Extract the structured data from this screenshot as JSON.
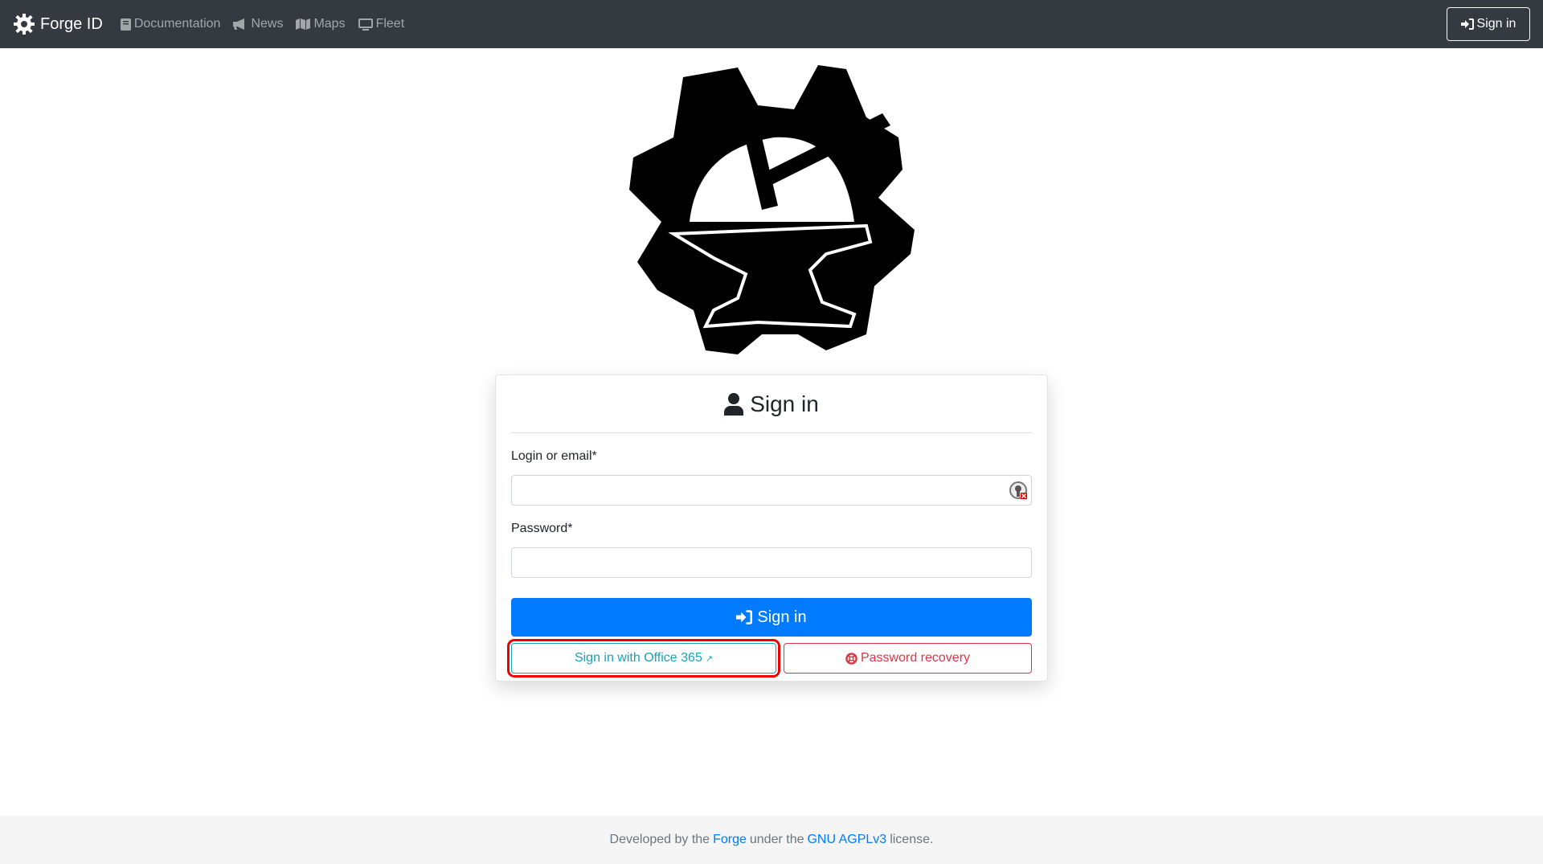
{
  "navbar": {
    "brand": "Forge ID",
    "links": [
      {
        "label": "Documentation",
        "icon": "book-icon"
      },
      {
        "label": "News",
        "icon": "bullhorn-icon"
      },
      {
        "label": "Maps",
        "icon": "map-icon"
      },
      {
        "label": "Fleet",
        "icon": "desktop-icon"
      }
    ],
    "signin_label": "Sign in"
  },
  "card": {
    "title": "Sign in",
    "login_label": "Login or email*",
    "login_value": "",
    "password_label": "Password*",
    "password_value": "",
    "submit_label": "Sign in",
    "office_label": "Sign in with Office 365",
    "recovery_label": "Password recovery"
  },
  "footer": {
    "prefix": "Developed by the",
    "forge_link": "Forge",
    "middle": "under the",
    "license_link": "GNU AGPLv3",
    "suffix": "license."
  },
  "colors": {
    "primary": "#007bff",
    "info": "#17a2b8",
    "danger": "#dc3545",
    "navbar": "#343a40",
    "highlight": "#e00000"
  }
}
